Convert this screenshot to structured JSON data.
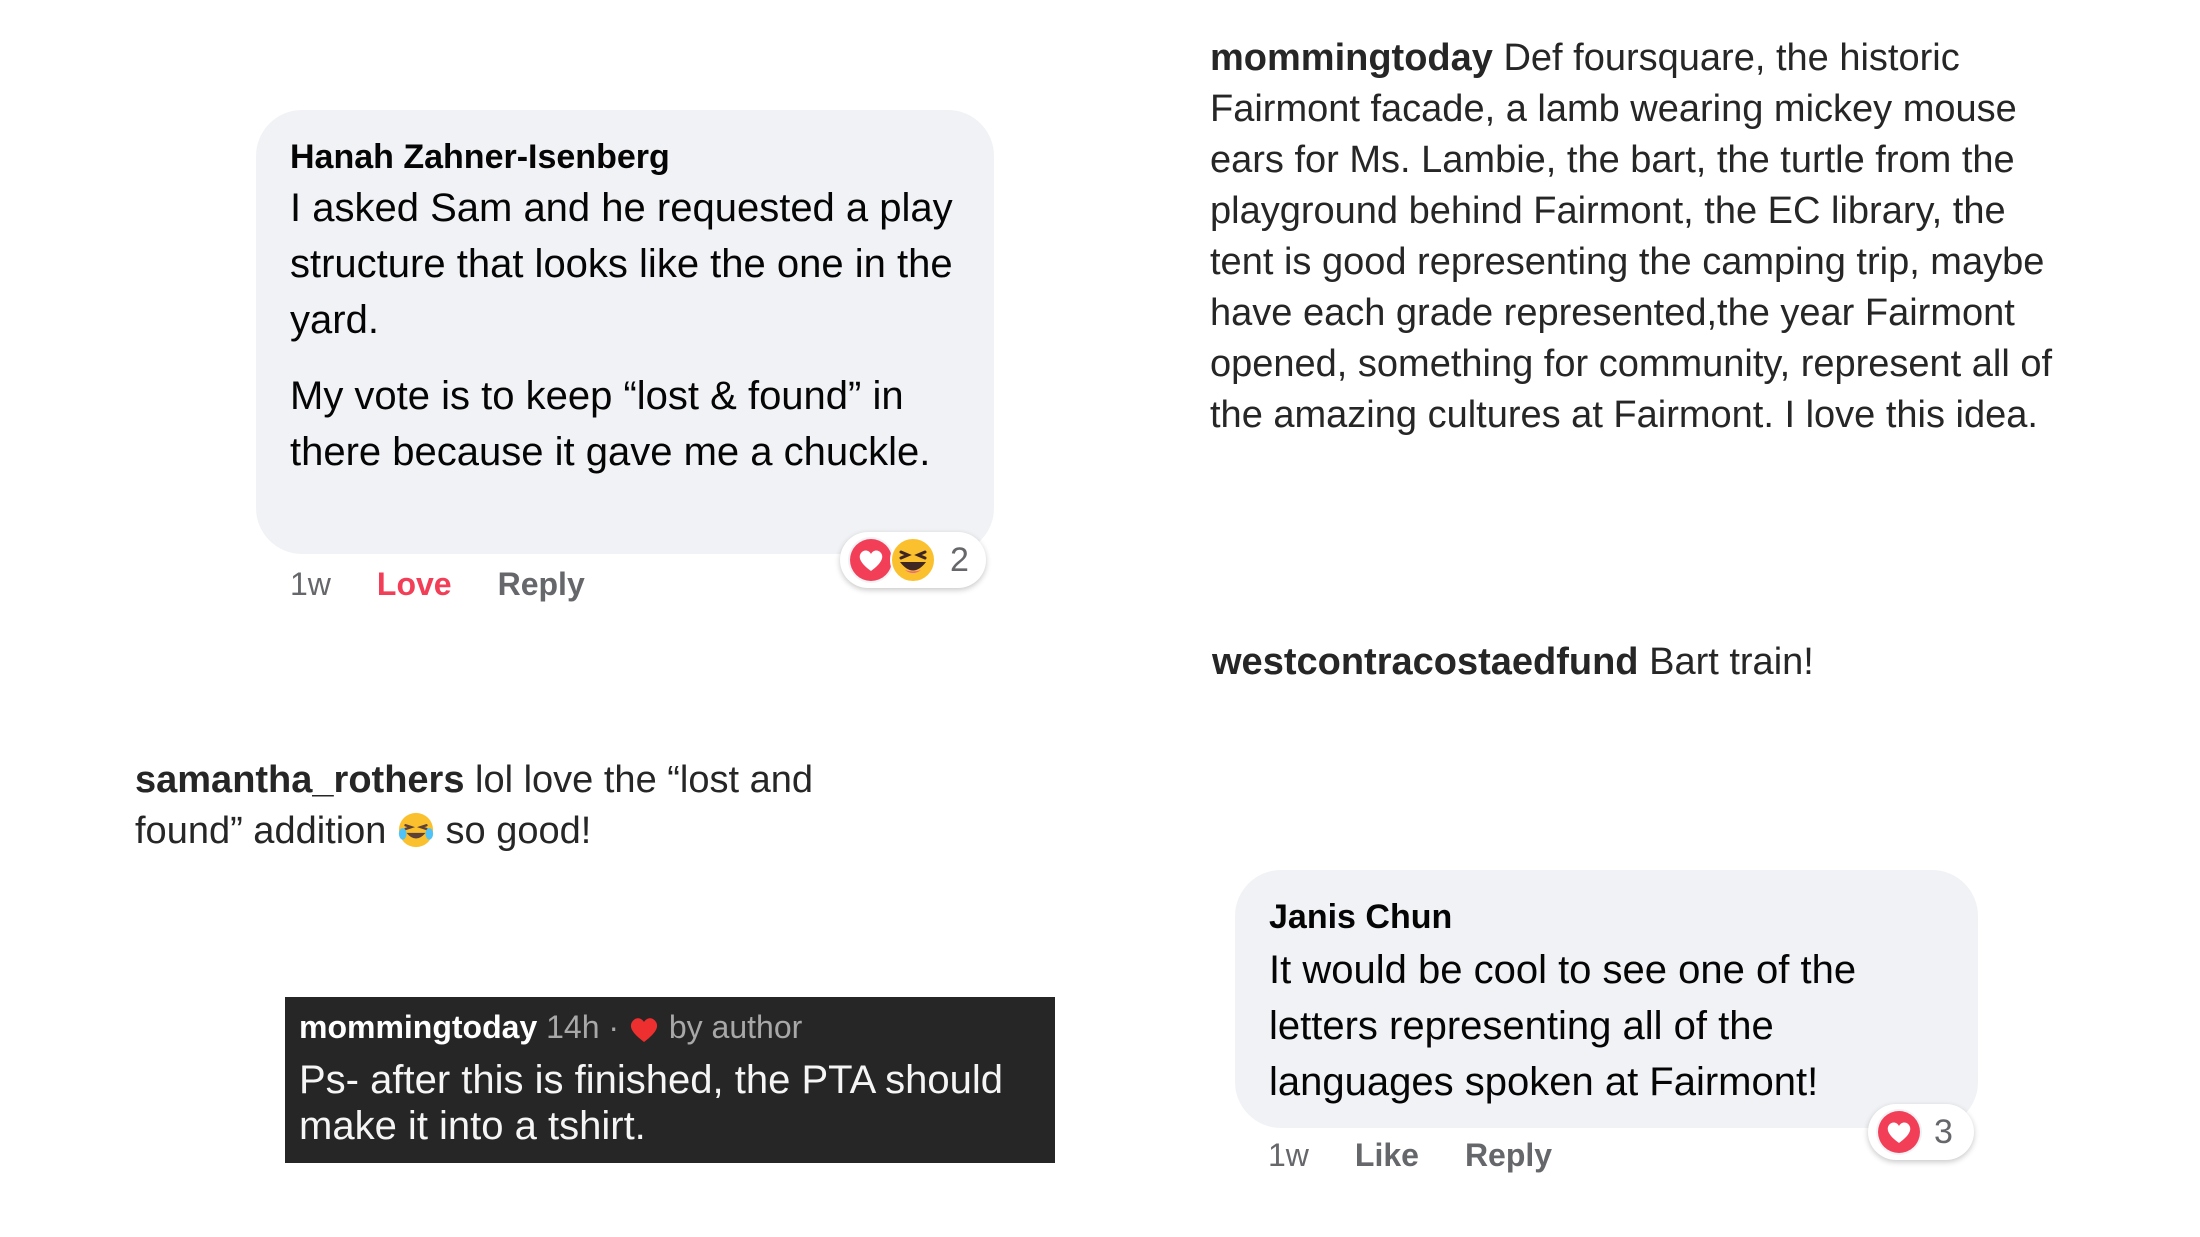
{
  "hanah": {
    "name": "Hanah Zahner-Isenberg",
    "text1": "I asked Sam and he requested a play structure that looks like the one in the yard.",
    "text2": "My vote is to keep “lost & found” in there because it gave me a chuckle.",
    "time": "1w",
    "love": "Love",
    "reply": "Reply",
    "reaction_count": "2"
  },
  "mommingtoday_main": {
    "username": "mommingtoday",
    "text": "Def foursquare, the historic Fairmont facade, a lamb wearing mickey mouse ears for Ms. Lambie, the bart, the turtle from the playground behind Fairmont, the EC library, the tent is good representing the camping trip, maybe have each grade represented,the year Fairmont opened, something for community, represent all of the amazing cultures at Fairmont. I love this idea."
  },
  "westcontra": {
    "username": "westcontracostaedfund",
    "text": "Bart train!"
  },
  "samantha": {
    "username": "samantha_rothers",
    "text_before": "lol love the “lost and found” addition",
    "emoji": "😂",
    "text_after": "so good!"
  },
  "mommingtoday_reply": {
    "username": "mommingtoday",
    "time": "14h",
    "separator": "·",
    "by_author": "by author",
    "text": "Ps- after this is finished, the PTA should make it into a tshirt."
  },
  "janis": {
    "name": "Janis Chun",
    "text": "It would be cool to see one of the letters representing all of the languages spoken at Fairmont!",
    "time": "1w",
    "like": "Like",
    "reply": "Reply",
    "reaction_count": "3"
  },
  "colors": {
    "bubble": "#f0f2f5",
    "love": "#f33e58",
    "dark_box": "#262626"
  },
  "icons": [
    "love-reaction-icon",
    "haha-reaction-icon",
    "heart-icon",
    "laughing-emoji"
  ]
}
